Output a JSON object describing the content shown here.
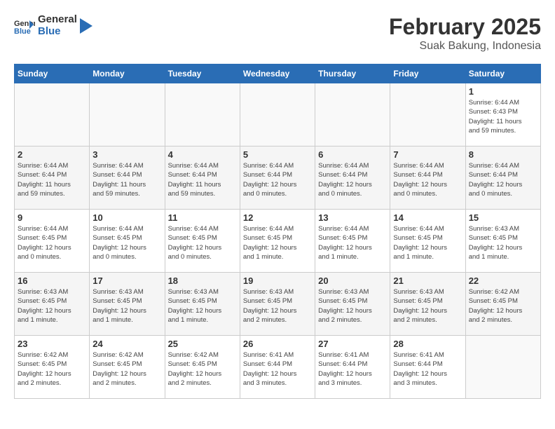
{
  "logo": {
    "general": "General",
    "blue": "Blue"
  },
  "title": {
    "month": "February 2025",
    "location": "Suak Bakung, Indonesia"
  },
  "weekdays": [
    "Sunday",
    "Monday",
    "Tuesday",
    "Wednesday",
    "Thursday",
    "Friday",
    "Saturday"
  ],
  "weeks": [
    [
      {
        "day": "",
        "info": ""
      },
      {
        "day": "",
        "info": ""
      },
      {
        "day": "",
        "info": ""
      },
      {
        "day": "",
        "info": ""
      },
      {
        "day": "",
        "info": ""
      },
      {
        "day": "",
        "info": ""
      },
      {
        "day": "1",
        "info": "Sunrise: 6:44 AM\nSunset: 6:43 PM\nDaylight: 11 hours\nand 59 minutes."
      }
    ],
    [
      {
        "day": "2",
        "info": "Sunrise: 6:44 AM\nSunset: 6:44 PM\nDaylight: 11 hours\nand 59 minutes."
      },
      {
        "day": "3",
        "info": "Sunrise: 6:44 AM\nSunset: 6:44 PM\nDaylight: 11 hours\nand 59 minutes."
      },
      {
        "day": "4",
        "info": "Sunrise: 6:44 AM\nSunset: 6:44 PM\nDaylight: 11 hours\nand 59 minutes."
      },
      {
        "day": "5",
        "info": "Sunrise: 6:44 AM\nSunset: 6:44 PM\nDaylight: 12 hours\nand 0 minutes."
      },
      {
        "day": "6",
        "info": "Sunrise: 6:44 AM\nSunset: 6:44 PM\nDaylight: 12 hours\nand 0 minutes."
      },
      {
        "day": "7",
        "info": "Sunrise: 6:44 AM\nSunset: 6:44 PM\nDaylight: 12 hours\nand 0 minutes."
      },
      {
        "day": "8",
        "info": "Sunrise: 6:44 AM\nSunset: 6:44 PM\nDaylight: 12 hours\nand 0 minutes."
      }
    ],
    [
      {
        "day": "9",
        "info": "Sunrise: 6:44 AM\nSunset: 6:45 PM\nDaylight: 12 hours\nand 0 minutes."
      },
      {
        "day": "10",
        "info": "Sunrise: 6:44 AM\nSunset: 6:45 PM\nDaylight: 12 hours\nand 0 minutes."
      },
      {
        "day": "11",
        "info": "Sunrise: 6:44 AM\nSunset: 6:45 PM\nDaylight: 12 hours\nand 0 minutes."
      },
      {
        "day": "12",
        "info": "Sunrise: 6:44 AM\nSunset: 6:45 PM\nDaylight: 12 hours\nand 1 minute."
      },
      {
        "day": "13",
        "info": "Sunrise: 6:44 AM\nSunset: 6:45 PM\nDaylight: 12 hours\nand 1 minute."
      },
      {
        "day": "14",
        "info": "Sunrise: 6:44 AM\nSunset: 6:45 PM\nDaylight: 12 hours\nand 1 minute."
      },
      {
        "day": "15",
        "info": "Sunrise: 6:43 AM\nSunset: 6:45 PM\nDaylight: 12 hours\nand 1 minute."
      }
    ],
    [
      {
        "day": "16",
        "info": "Sunrise: 6:43 AM\nSunset: 6:45 PM\nDaylight: 12 hours\nand 1 minute."
      },
      {
        "day": "17",
        "info": "Sunrise: 6:43 AM\nSunset: 6:45 PM\nDaylight: 12 hours\nand 1 minute."
      },
      {
        "day": "18",
        "info": "Sunrise: 6:43 AM\nSunset: 6:45 PM\nDaylight: 12 hours\nand 1 minute."
      },
      {
        "day": "19",
        "info": "Sunrise: 6:43 AM\nSunset: 6:45 PM\nDaylight: 12 hours\nand 2 minutes."
      },
      {
        "day": "20",
        "info": "Sunrise: 6:43 AM\nSunset: 6:45 PM\nDaylight: 12 hours\nand 2 minutes."
      },
      {
        "day": "21",
        "info": "Sunrise: 6:43 AM\nSunset: 6:45 PM\nDaylight: 12 hours\nand 2 minutes."
      },
      {
        "day": "22",
        "info": "Sunrise: 6:42 AM\nSunset: 6:45 PM\nDaylight: 12 hours\nand 2 minutes."
      }
    ],
    [
      {
        "day": "23",
        "info": "Sunrise: 6:42 AM\nSunset: 6:45 PM\nDaylight: 12 hours\nand 2 minutes."
      },
      {
        "day": "24",
        "info": "Sunrise: 6:42 AM\nSunset: 6:45 PM\nDaylight: 12 hours\nand 2 minutes."
      },
      {
        "day": "25",
        "info": "Sunrise: 6:42 AM\nSunset: 6:45 PM\nDaylight: 12 hours\nand 2 minutes."
      },
      {
        "day": "26",
        "info": "Sunrise: 6:41 AM\nSunset: 6:44 PM\nDaylight: 12 hours\nand 3 minutes."
      },
      {
        "day": "27",
        "info": "Sunrise: 6:41 AM\nSunset: 6:44 PM\nDaylight: 12 hours\nand 3 minutes."
      },
      {
        "day": "28",
        "info": "Sunrise: 6:41 AM\nSunset: 6:44 PM\nDaylight: 12 hours\nand 3 minutes."
      },
      {
        "day": "",
        "info": ""
      }
    ]
  ]
}
